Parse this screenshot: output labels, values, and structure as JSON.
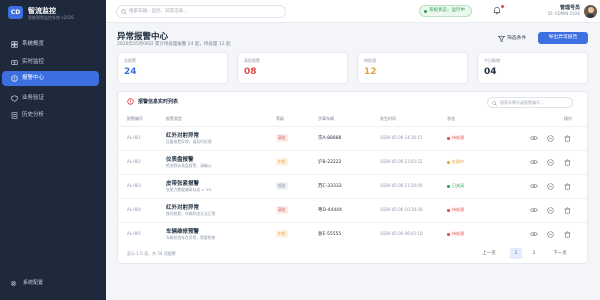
{
  "brand": {
    "logo_text": "CD",
    "title": "智流监控",
    "subtitle": "智能视频监控系统 v2026"
  },
  "nav": {
    "items": [
      {
        "label": "系统概览"
      },
      {
        "label": "实时监控"
      },
      {
        "label": "报警中心"
      },
      {
        "label": "业务验证"
      },
      {
        "label": "历史分析"
      }
    ],
    "settings_label": "系统配置",
    "active_index": 2
  },
  "topbar": {
    "search_placeholder": "搜索车辆、监控、异常记录...",
    "system_status": "系统状态：运行中",
    "user_name": "管理号员",
    "user_id": "ID: ADMIN-2026"
  },
  "page": {
    "title": "异常报警中心",
    "subtitle": "2026年05月06日 累计待处理报警 24 起，待处理 12 起",
    "filter_label": "筛选条件",
    "export_label": "导出异常报告"
  },
  "stats": [
    {
      "label": "总报警",
      "value": "24",
      "color": "#3e6fe0"
    },
    {
      "label": "高危报警",
      "value": "08",
      "color": "#e04b4b"
    },
    {
      "label": "待处理",
      "value": "12",
      "color": "#e6a23c"
    },
    {
      "label": "今日新增",
      "value": "04",
      "color": "#1f2d3d"
    }
  ],
  "table": {
    "title": "报警信息实时列表",
    "search_placeholder": "搜索车牌号或报警编号...",
    "columns": [
      "报警编号",
      "报警类型",
      "等级",
      "涉事车辆",
      "发生时间",
      "状态",
      "操作"
    ],
    "rows": [
      {
        "id": "AL-001",
        "type": "红外对射异常",
        "desc": "设备巡检异常，请及时处理",
        "level": "高危",
        "plate": "京A-88888",
        "time": "2026-05-06 14:30:15",
        "status": "待处理"
      },
      {
        "id": "AL-002",
        "type": "仪表盘报警",
        "desc": "检测到仪表盘报警，请确认",
        "level": "中危",
        "plate": "沪B-22222",
        "time": "2026-05-06 13:05:22",
        "status": "处理中"
      },
      {
        "id": "AL-003",
        "type": "皮带张紧报警",
        "desc": "张紧力数据偏离标准 > 5%",
        "level": "低危",
        "plate": "苏C-33333",
        "time": "2026-05-06 11:20:00",
        "status": "已关闭"
      },
      {
        "id": "AL-004",
        "type": "红外对射异常",
        "desc": "夜间巡检，车辆状态无法正常",
        "level": "高危",
        "plate": "粤D-44444",
        "time": "2026-05-06 10:10:30",
        "status": "待处理"
      },
      {
        "id": "AL-005",
        "type": "车辆维修预警",
        "desc": "车辆状态存在异常，需要检修",
        "level": "中危",
        "plate": "浙E-55555",
        "time": "2026-05-06 09:45:10",
        "status": "待处理"
      }
    ],
    "count_text": "显示 1-5 项，共 24 项报警",
    "pagination": {
      "prev": "上一页",
      "pages": [
        "1",
        "2"
      ],
      "next": "下一页"
    }
  },
  "level_colors": {
    "高危": {
      "bg": "#fdecec",
      "fg": "#e04b4b"
    },
    "中危": {
      "bg": "#fdf3e3",
      "fg": "#e6a23c"
    },
    "低危": {
      "bg": "#eef1f5",
      "fg": "#7a8494"
    }
  },
  "status_colors": {
    "待处理": "#e04b4b",
    "处理中": "#e6a23c",
    "已关闭": "#2e9b4f"
  },
  "icons": {
    "view": "eye-icon",
    "edit": "edit-icon",
    "delete": "delete-icon"
  }
}
